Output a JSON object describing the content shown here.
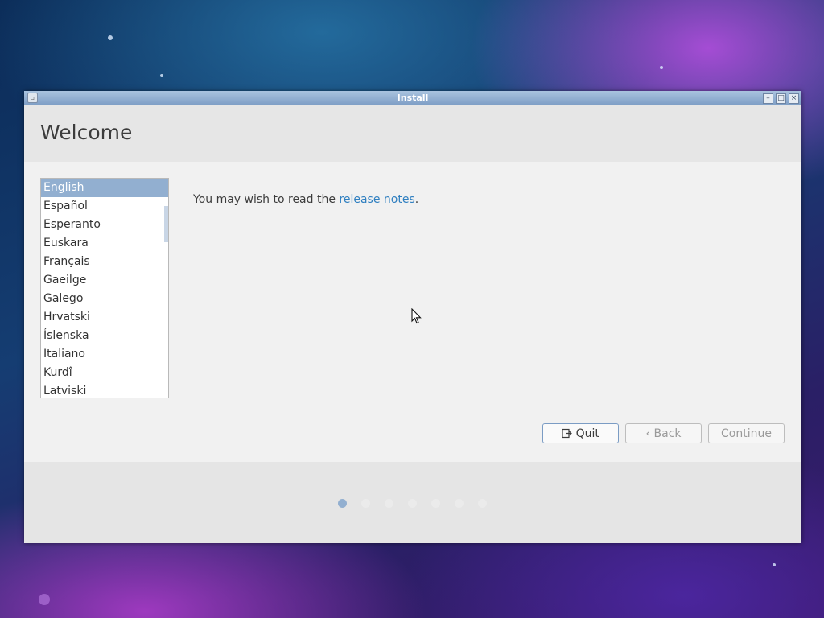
{
  "window": {
    "title": "Install",
    "controls": [
      "minimize",
      "maximize",
      "close"
    ]
  },
  "header": {
    "title": "Welcome"
  },
  "languages": [
    "English",
    "Español",
    "Esperanto",
    "Euskara",
    "Français",
    "Gaeilge",
    "Galego",
    "Hrvatski",
    "Íslenska",
    "Italiano",
    "Kurdî",
    "Latviski"
  ],
  "selected_language": "English",
  "notes": {
    "prefix": "You may wish to read the ",
    "link": "release notes",
    "suffix": "."
  },
  "buttons": {
    "quit": "Quit",
    "back": "Back",
    "continue": "Continue"
  },
  "progress": {
    "steps": 7,
    "current": 1
  },
  "colors": {
    "accent": "#92afd0",
    "link": "#2f7fc0",
    "titlebar": "#8fadd0"
  },
  "icons": {
    "app": "app-icon",
    "minimize": "minimize-icon",
    "maximize": "maximize-icon",
    "close": "close-icon",
    "quit": "exit-icon",
    "back": "chevron-left-icon"
  }
}
